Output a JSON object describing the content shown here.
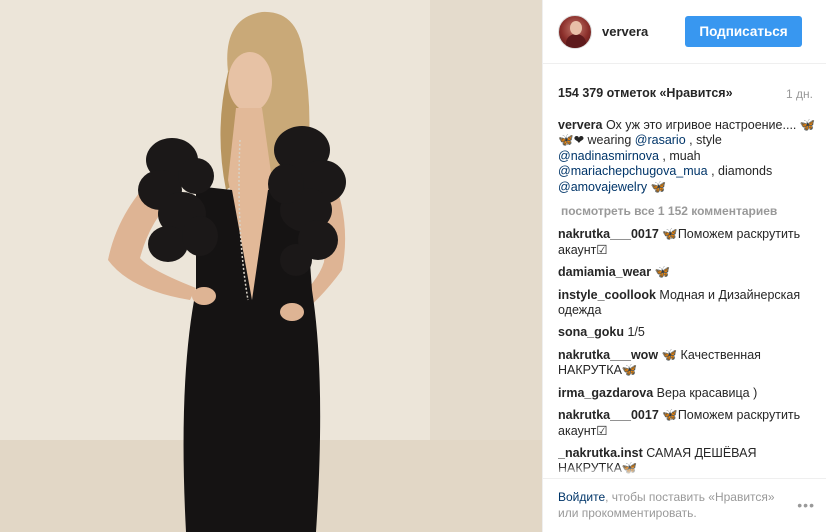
{
  "header": {
    "username": "ververa",
    "follow_label": "Подписаться"
  },
  "post": {
    "likes": "154 379 отметок «Нравится»",
    "time": "1 дн."
  },
  "caption": {
    "author": "ververa",
    "text_1": " Ох уж это игривое настроение.... 🦋🦋❤ wearing ",
    "mention_1": "@rasario",
    "text_2": " , style ",
    "mention_2": "@nadinasmirnova",
    "text_3": " , muah ",
    "mention_3": "@mariachepchugova_mua",
    "text_4": " , diamonds ",
    "mention_4": "@amovajewelry",
    "text_5": " 🦋"
  },
  "more_comments_label": "посмотреть все 1 152 комментариев",
  "comments": [
    {
      "author": "nakrutka___0017",
      "text": " 🦋Поможем раскрутить акаунт☑"
    },
    {
      "author": "damiamia_wear",
      "text": " 🦋"
    },
    {
      "author": "instyle_coollook",
      "text": " Модная и Дизайнерская одежда"
    },
    {
      "author": "sona_goku",
      "text": " 1/5"
    },
    {
      "author": "nakrutka___wow",
      "text": " 🦋 Качественная НАКРУТКА🦋"
    },
    {
      "author": "irma_gazdarova",
      "text": " Вера красавица )"
    },
    {
      "author": "nakrutka___0017",
      "text": " 🦋Поможем раскрутить акаунт☑"
    },
    {
      "author": "_nakrutka.inst",
      "text": " САМАЯ ДЕШЁВАЯ НАКРУТКА🦋"
    }
  ],
  "footer": {
    "login_label": "Войдите",
    "text": ", чтобы поставить «Нравится» или прокомментировать.",
    "more_icon": "•••"
  }
}
